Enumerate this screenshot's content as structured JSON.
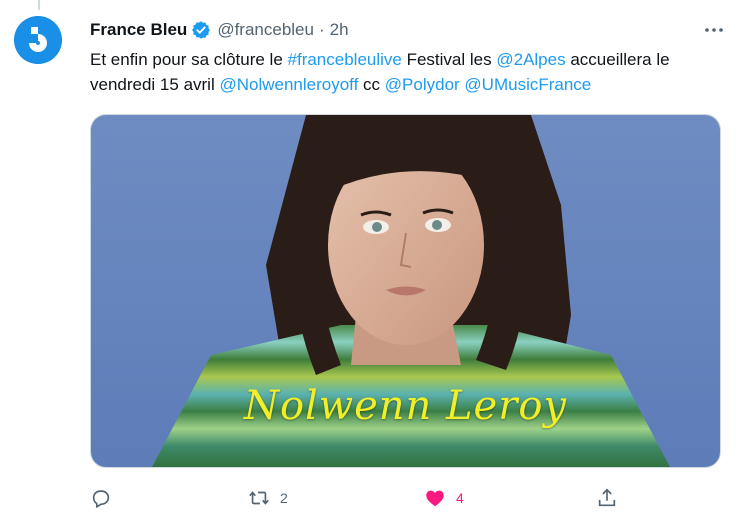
{
  "tweet": {
    "author_name": "France Bleu",
    "handle": "@francebleu",
    "separator": "·",
    "time": "2h",
    "text_parts": [
      {
        "text": "Et enfin pour sa clôture le ",
        "type": "plain"
      },
      {
        "text": "#francebleulive",
        "type": "link"
      },
      {
        "text": " Festival les ",
        "type": "plain"
      },
      {
        "text": "@2Alpes",
        "type": "link"
      },
      {
        "text": " accueillera le vendredi 15 avril ",
        "type": "plain"
      },
      {
        "text": "@Nolwennleroyoff",
        "type": "link"
      },
      {
        "text": " cc ",
        "type": "plain"
      },
      {
        "text": "@Polydor",
        "type": "link"
      },
      {
        "text": " ",
        "type": "plain"
      },
      {
        "text": "@UMusicFrance",
        "type": "link"
      }
    ],
    "media": {
      "caption": "Nolwenn Leroy",
      "description_icon": "photo-portrait"
    }
  },
  "actions": {
    "reply": {
      "icon": "reply-icon",
      "count": ""
    },
    "retweet": {
      "icon": "retweet-icon",
      "count": "2"
    },
    "like": {
      "icon": "heart-icon",
      "count": "4",
      "active": true
    },
    "share": {
      "icon": "share-icon",
      "count": ""
    }
  },
  "colors": {
    "link": "#1d9bf0",
    "muted": "#536471",
    "like": "#f91880",
    "brand": "#1a8fe8",
    "caption": "#f2ee28"
  }
}
